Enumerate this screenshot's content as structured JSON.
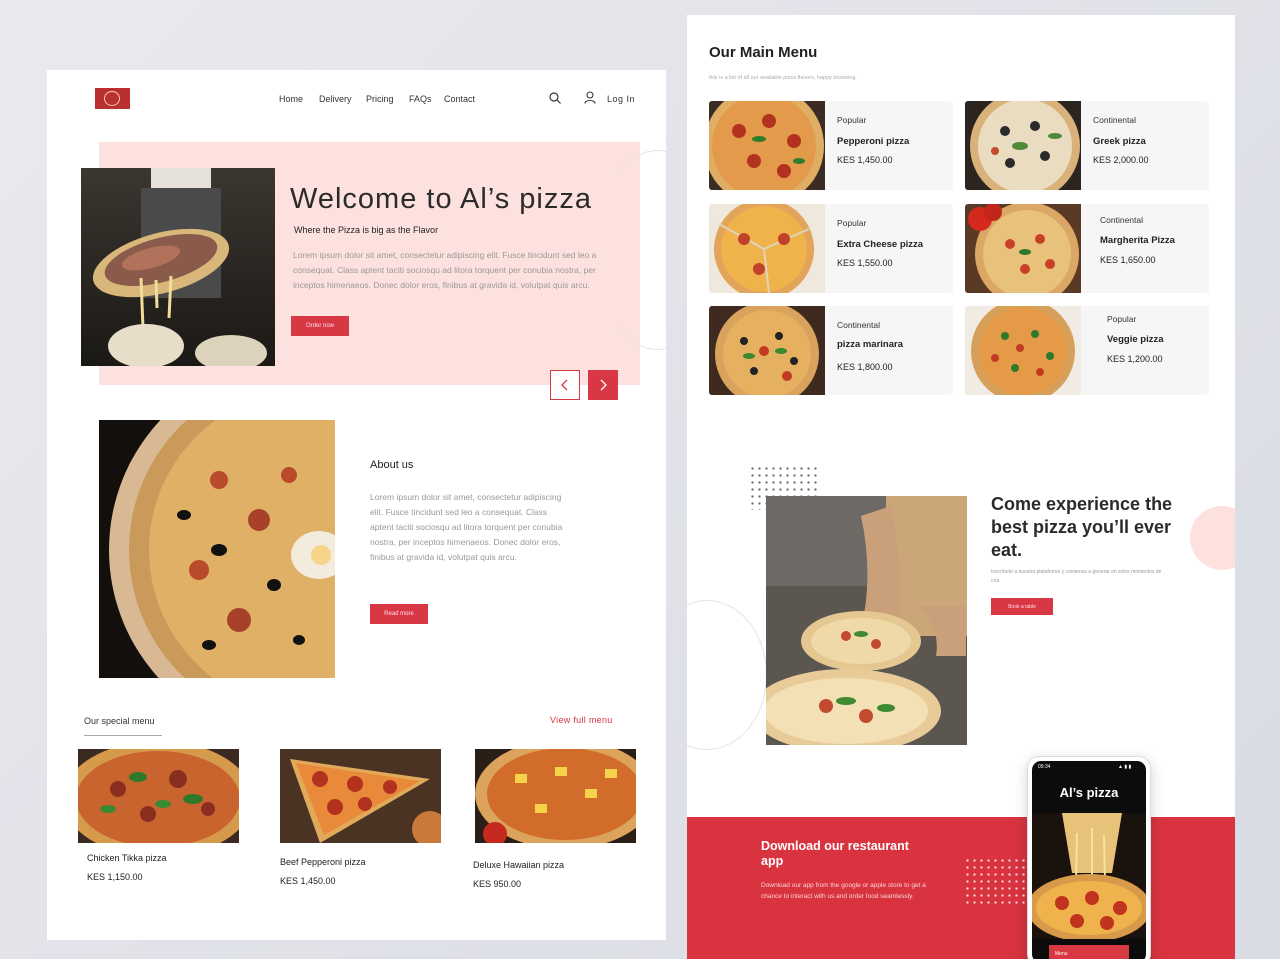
{
  "landing": {
    "nav": {
      "items": [
        "Home",
        "Delivery",
        "Pricing",
        "FAQs",
        "Contact"
      ],
      "login": "Log In"
    },
    "hero": {
      "title": "Welcome to Al’s pizza",
      "tagline": "Where the Pizza is big as the Flavor",
      "body": "Lorem ipsum dolor sit amet, consectetur adipiscing elit. Fusce tincidunt sed leo a consequat. Class aptent taciti sociosqu ad litora torquent per conubia nostra, per inceptos himenaeos. Donec dolor eros, finibus at gravida id, volutpat quis arcu.",
      "cta": "Order now"
    },
    "about": {
      "heading": "About us",
      "body": "Lorem ipsum dolor sit amet, consectetur adipiscing elit. Fusce tincidunt sed leo a consequat. Class aptent taciti sociosqu ad litora torquent per conubia nostra, per inceptos himenaeos. Donec dolor eros, finibus at gravida id, volutpat quis arcu.",
      "cta": "Read more"
    },
    "special": {
      "heading": "Our special menu",
      "view_all": "View full menu",
      "items": [
        {
          "name": "Chicken Tikka pizza",
          "price": "KES 1,150.00"
        },
        {
          "name": "Beef Pepperoni pizza",
          "price": "KES 1,450.00"
        },
        {
          "name": "Deluxe Hawaiian pizza",
          "price": "KES 950.00"
        }
      ]
    }
  },
  "menu": {
    "title": "Our Main Menu",
    "subtitle": "this is a list of all our available pizza flavors, happy browsing.",
    "items": [
      {
        "category": "Popular",
        "name": "Pepperoni pizza",
        "price": "KES 1,450.00"
      },
      {
        "category": "Continental",
        "name": "Greek pizza",
        "price": "KES 2,000.00"
      },
      {
        "category": "Popular",
        "name": "Extra Cheese pizza",
        "price": "KES 1,550.00"
      },
      {
        "category": "Continental",
        "name": "Margherita Pizza",
        "price": "KES 1,650.00"
      },
      {
        "category": "Continental",
        "name": "pizza marinara",
        "price": "KES 1,800.00"
      },
      {
        "category": "Popular",
        "name": "Veggie pizza",
        "price": "KES 1,200.00"
      }
    ]
  },
  "experience": {
    "heading": "Come experience the best pizza you’ll ever eat.",
    "body": "Inscríbete a nuestra plataforma y comienza a generar en solos momentos de cría",
    "cta": "Book a table"
  },
  "download": {
    "heading": "Download our restaurant app",
    "body": "Download our app from the google or apple store to get a chance to interact with us and order food seamlessly."
  },
  "phone": {
    "time": "09:34",
    "status": "▲ ▮ ▮",
    "title": "Al’s pizza",
    "button": "Menu"
  },
  "colors": {
    "accent": "#d73843",
    "hero_pink": "#fde1de",
    "logo_red": "#b8302f"
  }
}
